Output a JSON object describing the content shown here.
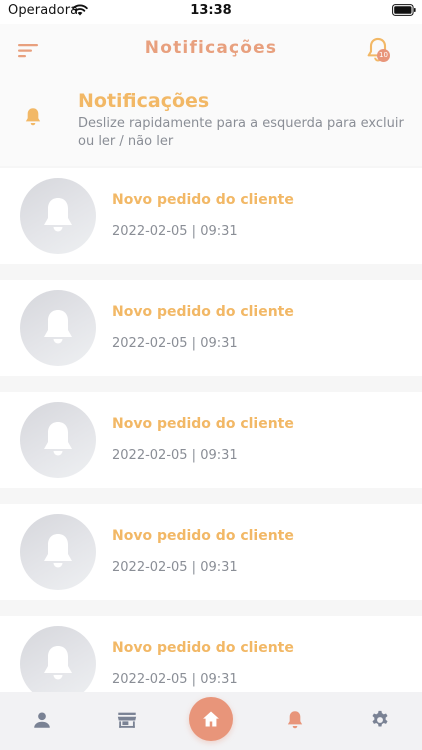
{
  "status_bar": {
    "carrier": "Operadora",
    "time": "13:38"
  },
  "header": {
    "title": "Notificações",
    "badge_count": "10",
    "accent_color": "#e8a07e",
    "bell_color": "#f2b866"
  },
  "banner": {
    "title": "Notificações",
    "subtitle": "Deslize rapidamente para a esquerda para excluir ou ler / não ler"
  },
  "notifications": [
    {
      "title": "Novo pedido do cliente",
      "time": "2022-02-05 | 09:31"
    },
    {
      "title": "Novo pedido do cliente",
      "time": "2022-02-05 | 09:31"
    },
    {
      "title": "Novo pedido do cliente",
      "time": "2022-02-05 | 09:31"
    },
    {
      "title": "Novo pedido do cliente",
      "time": "2022-02-05 | 09:31"
    },
    {
      "title": "Novo pedido do cliente",
      "time": "2022-02-05 | 09:31"
    }
  ],
  "tab_bar": {
    "items": [
      {
        "icon": "user-icon"
      },
      {
        "icon": "store-icon"
      },
      {
        "icon": "home-icon",
        "active": true
      },
      {
        "icon": "bell-icon"
      },
      {
        "icon": "gear-icon"
      }
    ]
  }
}
